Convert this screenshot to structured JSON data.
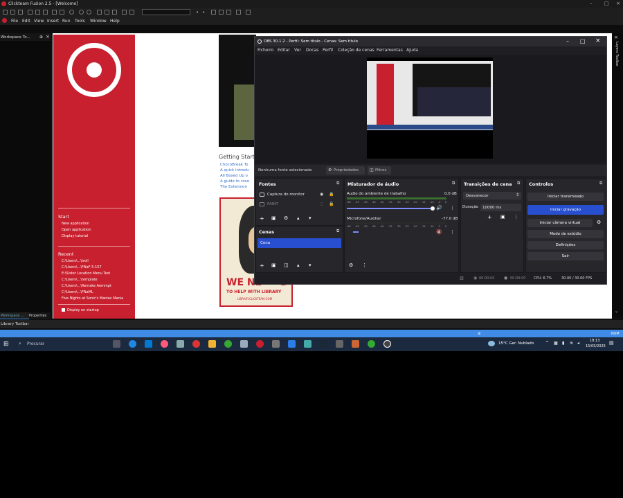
{
  "cf": {
    "title": "Clickteam Fusion 2.5 - [Welcome]",
    "menu": [
      "File",
      "Edit",
      "View",
      "Insert",
      "Run",
      "Tools",
      "Window",
      "Help"
    ],
    "workspace_title": "Workspace To...",
    "right_toolbar": "Layers Toolbar",
    "tab_workspace": "Workspace ...",
    "tab_properties": "Properties",
    "library_toolbar": "Library Toolbar"
  },
  "welcome": {
    "start_heading": "Start",
    "start_links": [
      "New application",
      "Open application",
      "Display tutorial"
    ],
    "recent_heading": "Recent",
    "recent_links": [
      "C:\\Users\\...\\troll",
      "C:\\Users\\...\\FNaF 5-157",
      "E:\\Sister Location Menu Test",
      "C:\\Users\\...\\template",
      "C:\\Users\\...\\Remake Aemmpt",
      "C:\\Users\\...\\FNaML",
      "Five Nights at Sonic's Maniac Mania"
    ],
    "display_on_startup": "Display on startup",
    "getting_started": "Getting Start",
    "gs_links": [
      "ChocoBreak To",
      "A quick introdu",
      "All Boxed Up o",
      "A guide to crea",
      "The Extension"
    ],
    "poster_big": "WE NE",
    "poster_big2": "D",
    "poster_small": "TO HELP WITH LIBRARY",
    "poster_link": "LIBRARY.CLICKTEAM.COM"
  },
  "obs": {
    "title": "OBS 30.1.2 - Perfil: Sem título - Cenas: Sem título",
    "menu": [
      "Ficheiro",
      "Editar",
      "Ver",
      "Docas",
      "Perfil",
      "Coleção de cenas",
      "Ferramentas",
      "Ajuda"
    ],
    "no_source": "Nenhuma fonte selecionada",
    "properties": "Propriedades",
    "filters": "Filtros",
    "sources_header": "Fontes",
    "sources": [
      "Captura do monitor",
      "PAINT"
    ],
    "scenes_header": "Cenas",
    "scenes": [
      "Cena"
    ],
    "mixer_header": "Misturador de áudio",
    "mixer": [
      {
        "name": "Áudio do ambiente de trabalho",
        "db": "0.0 dB",
        "level": 0.95,
        "muted": false
      },
      {
        "name": "Microfone/Auxiliar",
        "db": "-77.0 dB",
        "level": 0.05,
        "muted": true
      }
    ],
    "meter_ticks": [
      "-60",
      "-55",
      "-50",
      "-45",
      "-40",
      "-35",
      "-30",
      "-25",
      "-20",
      "-15",
      "-10",
      "-5",
      "0"
    ],
    "transitions_header": "Transições de cena",
    "transition": "Desvanecer",
    "duration_label": "Duração",
    "duration_value": "10000 ms",
    "controls_header": "Controlos",
    "controls": [
      "Iniciar transmissão",
      "Iniciar gravação",
      "Iniciar câmera virtual",
      "Modo de estúdio",
      "Definições",
      "Sair"
    ],
    "status": {
      "t1": "00:00:00",
      "t2": "00:00:00",
      "cpu": "CPU: 6.7%",
      "fps": "30.00 / 30.00 FPS"
    }
  },
  "taskbar": {
    "search": "Procurar",
    "weather": "15°C  Ger. Nublado",
    "time": "18:13",
    "date": "15/05/2025",
    "num": "NUM"
  }
}
